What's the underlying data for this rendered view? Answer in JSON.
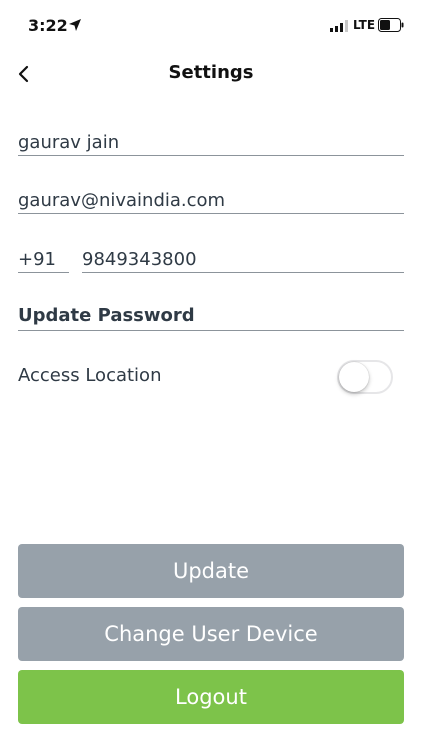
{
  "status_bar": {
    "time": "3:22",
    "network": "LTE"
  },
  "nav": {
    "title": "Settings"
  },
  "form": {
    "name_value": "gaurav jain",
    "email_value": "gaurav@nivaindia.com",
    "country_code": "+91",
    "phone_value": "9849343800",
    "update_password_label": "Update Password",
    "access_location_label": "Access Location",
    "access_location_enabled": false
  },
  "buttons": {
    "update": "Update",
    "change_device": "Change User Device",
    "logout": "Logout"
  },
  "colors": {
    "primary_button": "#97a1aa",
    "logout_button": "#7dc34a",
    "text": "#2f3a45"
  }
}
